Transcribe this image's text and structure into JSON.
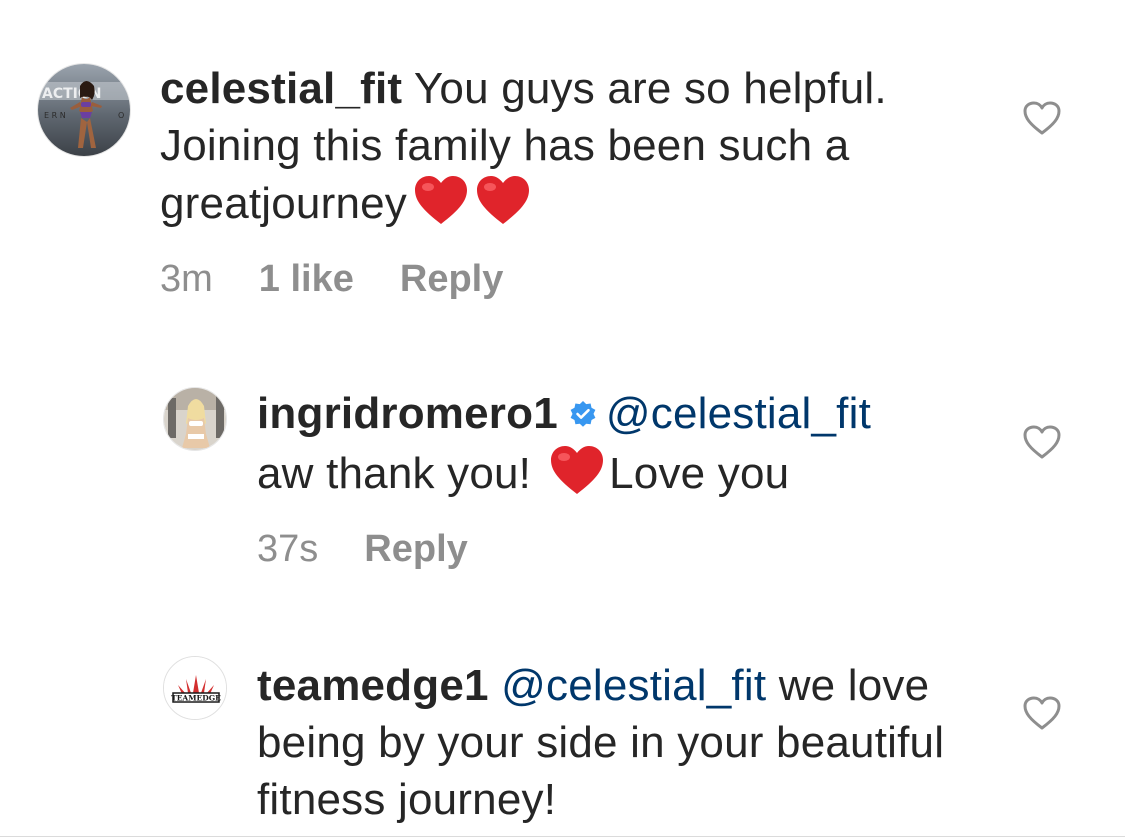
{
  "comments": [
    {
      "username": "celestial_fit",
      "text": "You guys are so helpful. Joining this family has been such a greatjourney",
      "emoji": [
        "red-heart",
        "red-heart"
      ],
      "time": "3m",
      "likes": "1 like",
      "reply": "Reply",
      "avatar": "celestial-fit-avatar"
    },
    {
      "username": "ingridromero1",
      "verified": true,
      "mention": "@celestial_fit",
      "text_before_emoji": "aw thank you!",
      "emoji": [
        "red-heart"
      ],
      "text_after_emoji": "Love you",
      "time": "37s",
      "reply": "Reply",
      "avatar": "ingridromero1-avatar"
    },
    {
      "username": "teamedge1",
      "mention": "@celestial_fit",
      "text": "we love being by your side in your beautiful fitness journey!",
      "avatar_logo_text": "TEAMEDGE",
      "avatar": "teamedge-logo-avatar"
    }
  ],
  "colors": {
    "text": "#262626",
    "meta": "#8e8e8e",
    "mention": "#00376b",
    "verified": "#3897f0",
    "heart_emoji": "#e0242b",
    "like_icon": "#8e8e8e"
  },
  "icons": {
    "like": "heart-outline-icon",
    "verified": "verified-badge-icon"
  }
}
